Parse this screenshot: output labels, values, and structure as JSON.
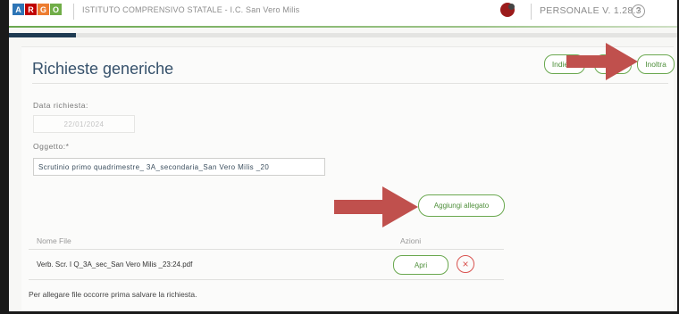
{
  "header": {
    "logo_letters": [
      "A",
      "R",
      "G",
      "O"
    ],
    "logo_colors": [
      "#2e75b6",
      "#c00000",
      "#ed7d31",
      "#70ad47"
    ],
    "school_name": "ISTITUTO COMPRENSIVO STATALE - I.C. San Vero Milis",
    "version": "PERSONALE V. 1.28.3",
    "help_glyph": "?",
    "icons": [
      "user-icon",
      "help-icon"
    ]
  },
  "progress": {
    "fraction": 0.1
  },
  "form": {
    "title": "Richieste generiche",
    "buttons": {
      "indietro": "Indietro",
      "salva": "Salva",
      "inoltra": "Inoltra"
    },
    "date_label": "Data richiesta:",
    "date_value": "22/01/2024",
    "subject_label": "Oggetto:*",
    "subject_value": "Scrutinio primo quadrimestre_ 3A_secondaria_San Vero Milis _20",
    "attach_button": "Aggiungi allegato"
  },
  "attachments": {
    "columns": [
      "Nome File",
      "Azioni"
    ],
    "rows": [
      {
        "name": "Verb. Scr. I Q_3A_sec_San Vero Milis _23:24.pdf",
        "open_label": "Apri",
        "delete_glyph": "×"
      }
    ],
    "note": "Per allegare file occorre prima salvare la richiesta."
  },
  "colors": {
    "accent_green": "#6aa84f",
    "title_blue": "#36516b",
    "arrow": "#c0504d",
    "delete_red": "#d9534f"
  }
}
